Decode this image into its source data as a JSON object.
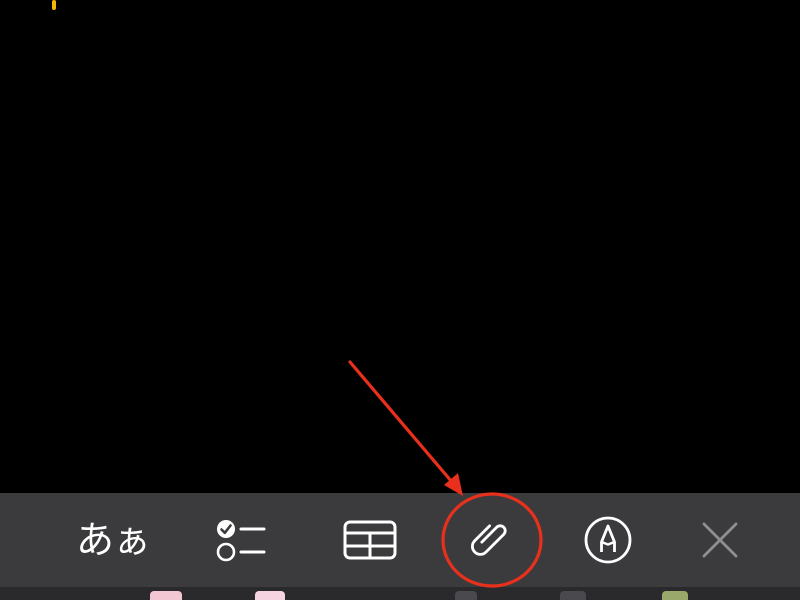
{
  "note": {
    "cursor_icon": "text-cursor"
  },
  "toolbar": {
    "format_label": "あぁ",
    "items": [
      {
        "name": "format",
        "icon": "text-format-icon"
      },
      {
        "name": "checklist",
        "icon": "checklist-icon"
      },
      {
        "name": "table",
        "icon": "table-icon"
      },
      {
        "name": "attachment",
        "icon": "paperclip-icon"
      },
      {
        "name": "markup",
        "icon": "markup-pen-icon"
      },
      {
        "name": "close",
        "icon": "close-icon"
      }
    ]
  },
  "annotation": {
    "target": "attachment",
    "shapes": [
      "arrow",
      "circle"
    ]
  },
  "colors": {
    "background": "#000000",
    "toolbar": "#3b3b3d",
    "icon": "#ffffff",
    "disabled_icon": "#8e8e93",
    "cursor": "#f5b800",
    "annotation": "#e8301c"
  }
}
